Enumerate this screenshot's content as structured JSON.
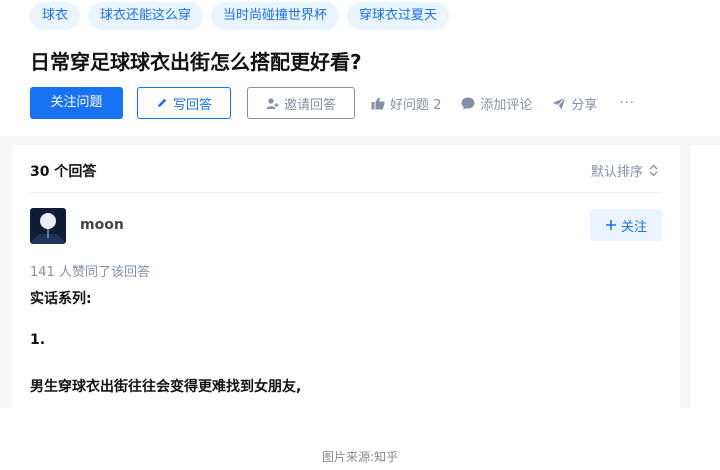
{
  "tags": [
    "球衣",
    "球衣还能这么穿",
    "当时尚碰撞世界杯",
    "穿球衣过夏天"
  ],
  "question": {
    "title": "日常穿足球球衣出街怎么搭配更好看?"
  },
  "actions": {
    "follow_question": "关注问题",
    "write_answer": "写回答",
    "invite_answer": "邀请回答",
    "good_question": "好问题 2",
    "add_comment": "添加评论",
    "share": "分享",
    "more": "···"
  },
  "answers": {
    "count_label": "30 个回答",
    "sort_label": "默认排序"
  },
  "answer": {
    "author": "moon",
    "follow_label": "关注",
    "likes_text": "141 人赞同了该回答",
    "paragraphs": [
      "实话系列:",
      "1.",
      "男生穿球衣出街往往会变得更难找到女朋友,"
    ]
  },
  "caption": "图片来源:知乎",
  "colors": {
    "accent": "#1772f6",
    "tag_bg": "#ebf5ff",
    "muted": "#8590a6"
  },
  "icons": [
    "pencil-icon",
    "invite-user-icon",
    "thumbs-up-icon",
    "comment-bubble-icon",
    "share-plane-icon",
    "sort-chevrons-icon",
    "plus-icon"
  ]
}
